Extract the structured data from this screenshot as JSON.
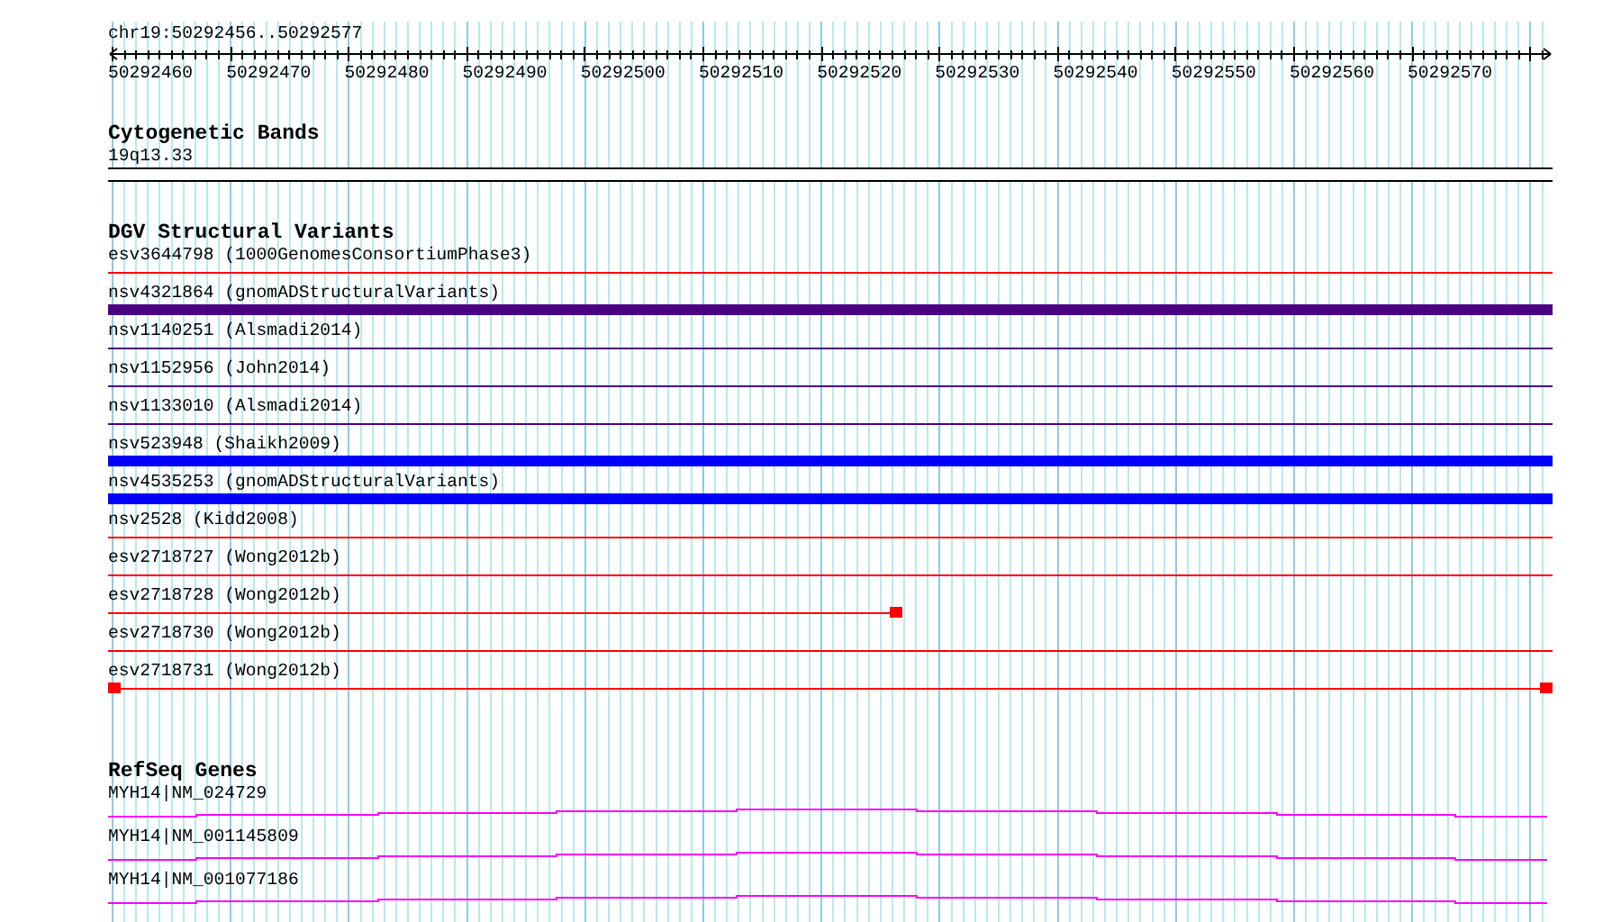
{
  "ruler": {
    "location": "chr19:50292456..50292577",
    "labels": [
      "50292460",
      "50292470",
      "50292480",
      "50292490",
      "50292500",
      "50292510",
      "50292520",
      "50292530",
      "50292540",
      "50292550",
      "50292560",
      "50292570"
    ]
  },
  "tracks": [
    {
      "kind": "cytoband",
      "title": "Cytogenetic Bands",
      "features": [
        {
          "label": "19q13.33"
        }
      ]
    },
    {
      "kind": "variants",
      "title": "DGV Structural Variants",
      "features": [
        {
          "label": "esv3644798 (1000GenomesConsortiumPhase3)",
          "color": "#ff0000",
          "thick": false,
          "partial": false,
          "start_mark": false,
          "end_mark": false
        },
        {
          "label": "nsv4321864 (gnomADStructuralVariants)",
          "color": "#4b0082",
          "thick": true,
          "partial": false,
          "start_mark": false,
          "end_mark": false
        },
        {
          "label": "nsv1140251 (Alsmadi2014)",
          "color": "#4b0082",
          "thick": false,
          "partial": false,
          "start_mark": false,
          "end_mark": false
        },
        {
          "label": "nsv1152956 (John2014)",
          "color": "#4b0082",
          "thick": false,
          "partial": false,
          "start_mark": false,
          "end_mark": false
        },
        {
          "label": "nsv1133010 (Alsmadi2014)",
          "color": "#4b0082",
          "thick": false,
          "partial": false,
          "start_mark": false,
          "end_mark": false
        },
        {
          "label": "nsv523948 (Shaikh2009)",
          "color": "#0000ff",
          "thick": true,
          "partial": false,
          "start_mark": false,
          "end_mark": false
        },
        {
          "label": "nsv4535253 (gnomADStructuralVariants)",
          "color": "#0000ff",
          "thick": true,
          "partial": false,
          "start_mark": false,
          "end_mark": false
        },
        {
          "label": "nsv2528 (Kidd2008)",
          "color": "#ff0000",
          "thick": false,
          "partial": false,
          "start_mark": false,
          "end_mark": false
        },
        {
          "label": "esv2718727 (Wong2012b)",
          "color": "#ff0000",
          "thick": false,
          "partial": false,
          "start_mark": false,
          "end_mark": false
        },
        {
          "label": "esv2718728 (Wong2012b)",
          "color": "#ff0000",
          "thick": false,
          "partial": true,
          "start_mark": false,
          "end_mark": true
        },
        {
          "label": "esv2718730 (Wong2012b)",
          "color": "#ff0000",
          "thick": false,
          "partial": false,
          "start_mark": false,
          "end_mark": false
        },
        {
          "label": "esv2718731 (Wong2012b)",
          "color": "#ff0000",
          "thick": false,
          "partial": false,
          "start_mark": true,
          "end_mark": true
        }
      ]
    },
    {
      "kind": "genes",
      "title": "RefSeq Genes",
      "features": [
        {
          "label": "MYH14|NM_024729"
        },
        {
          "label": "MYH14|NM_001145809"
        },
        {
          "label": "MYH14|NM_001077186"
        }
      ]
    }
  ]
}
